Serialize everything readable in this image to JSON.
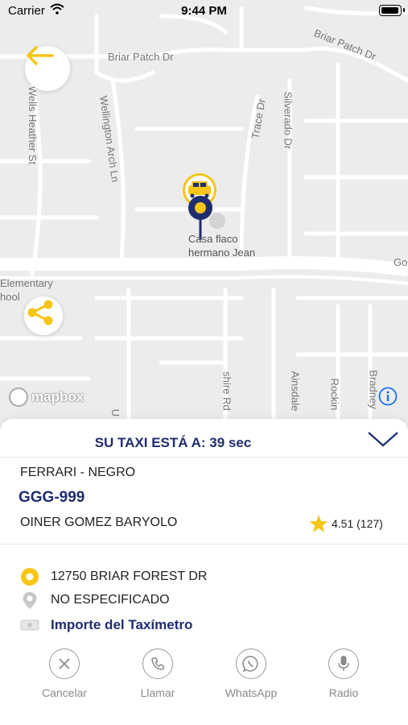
{
  "status_bar": {
    "carrier": "Carrier",
    "time": "9:44 PM"
  },
  "map": {
    "streets": [
      "Briar Patch Dr",
      "Briar Patch Dr",
      "Wells Heather St",
      "Wellington Arch Ln",
      "Trace Dr",
      "Silverado Dr",
      "Elementary",
      "hool",
      "Go",
      "shire Rd",
      "Ainsdale",
      "Rockin",
      "Bradney",
      "U"
    ],
    "pin_label_line1": "Casa flaco",
    "pin_label_line2": "hermano Jean",
    "attribution": "mapbox",
    "colors": {
      "taxi_yellow": "#f5c518",
      "pin_navy": "#1f2d6e",
      "map_bg": "#ececec"
    }
  },
  "trip": {
    "eta_text": "SU TAXI ESTÁ A: 39 sec",
    "car_description": "FERRARI - NEGRO",
    "plate": "GGG-999",
    "driver_name": "OINER GOMEZ BARYOLO",
    "rating": "4.51 (127)",
    "pickup_address": "12750 BRIAR FOREST DR",
    "destination": "NO ESPECIFICADO",
    "fare_label": "Importe del Taxímetro"
  },
  "actions": [
    {
      "label": "Cancelar",
      "icon": "close-icon"
    },
    {
      "label": "Llamar",
      "icon": "phone-icon"
    },
    {
      "label": "WhatsApp",
      "icon": "whatsapp-icon"
    },
    {
      "label": "Radio",
      "icon": "microphone-icon"
    }
  ]
}
